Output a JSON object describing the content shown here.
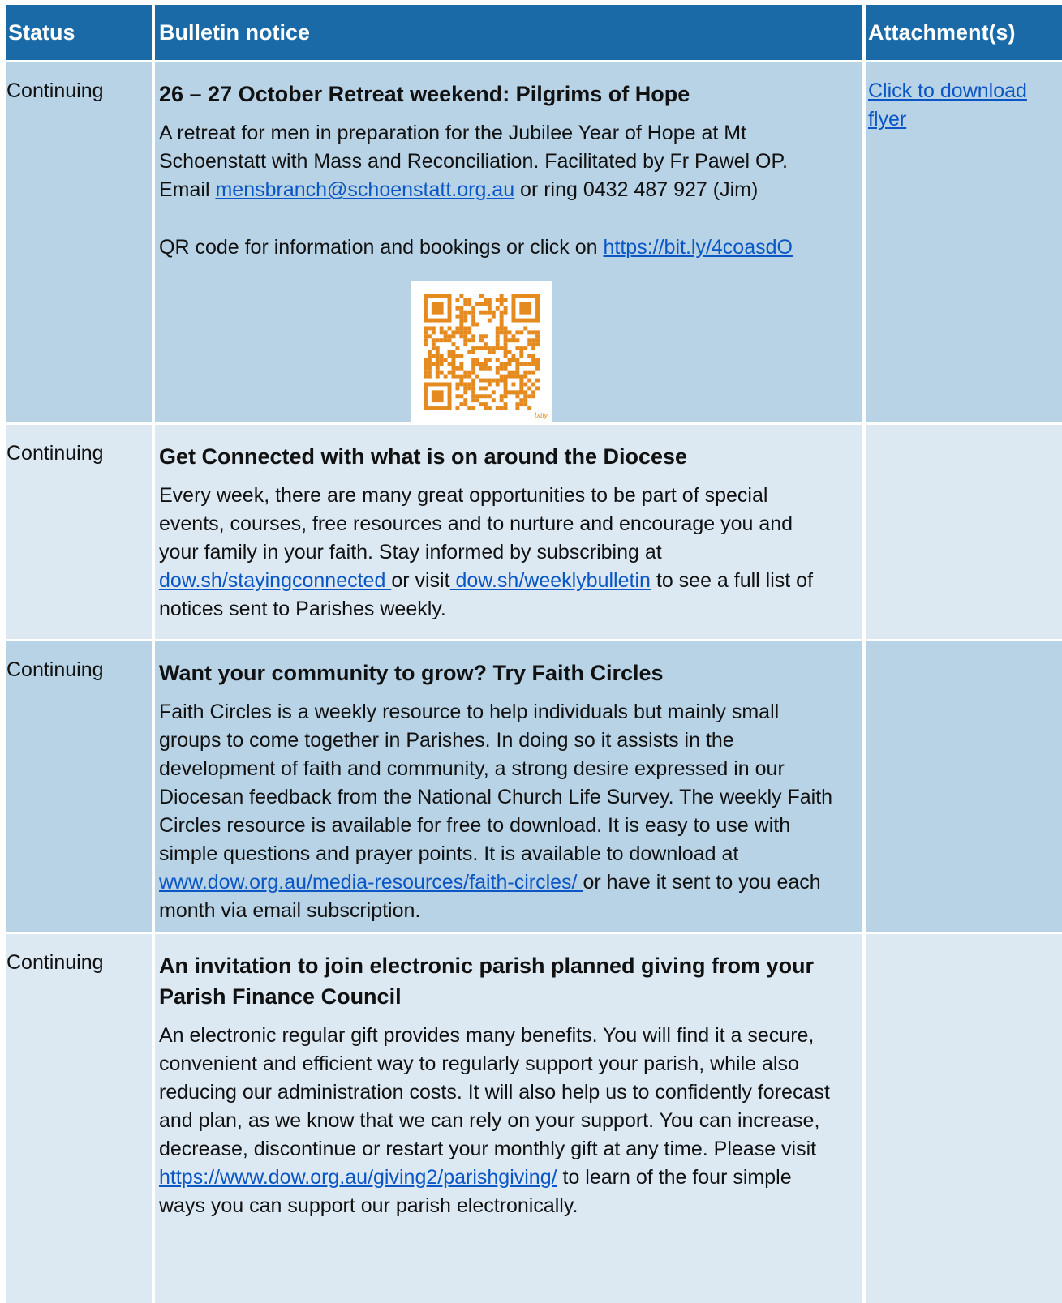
{
  "header": {
    "status": "Status",
    "notice": "Bulletin notice",
    "attachment": "Attachment(s)"
  },
  "rows": [
    {
      "status": "Continuing",
      "title": "26 – 27 October Retreat weekend: Pilgrims of Hope",
      "p1_text": "A retreat for men in preparation for the Jubilee Year of Hope at Mt Schoenstatt with Mass and Reconciliation. Facilitated by Fr Pawel OP. Email ",
      "p1_link": "mensbranch@schoenstatt.org.au",
      "p1_after": " or ring 0432 487 927 (Jim)",
      "p2_text": "QR code for information and bookings or click on ",
      "p2_link": "https://bit.ly/4coasdO",
      "qr_caption": "bitly",
      "attachment_link": "Click to download flyer"
    },
    {
      "status": "Continuing",
      "title": "Get Connected with what is on around the Diocese",
      "p1_text": "Every week, there are many great opportunities to be part of special events, courses, free resources and to nurture and encourage you and your family in your faith. Stay informed by subscribing at ",
      "p1_link": "dow.sh/stayingconnected ",
      "p1_mid": "or visit",
      "p1_link2": " dow.sh/weeklybulletin",
      "p1_after": " to see a full list of notices sent to Parishes weekly."
    },
    {
      "status": "Continuing",
      "title": "Want your community to grow? Try Faith Circles",
      "p1_text": "Faith Circles is a weekly resource to help individuals but mainly small groups to come together in Parishes. In doing so it assists in the development of faith and community, a strong desire expressed in our Diocesan feedback from the National Church Life Survey.  The weekly Faith Circles resource is available for free to download. It is easy to use with simple questions and prayer points. It is available to download at ",
      "p1_link": "www.dow.org.au/media-resources/faith-circles/ ",
      "p1_after": "or have it sent to you each month via email subscription."
    },
    {
      "status": "Continuing",
      "title": "An invitation to join electronic parish planned giving from your Parish Finance Council",
      "p1_text": "An electronic regular gift provides many benefits. You will find it a secure, convenient and efficient way to regularly support your parish, while also reducing our administration costs. It will also help us to confidently forecast and plan, as we know that we can rely on your support. You can increase, decrease, discontinue or restart your monthly gift at any time. Please visit ",
      "p1_link": "https://www.dow.org.au/giving2/parishgiving/",
      "p1_after": " to learn of the four simple ways you can support our parish electronically."
    }
  ],
  "colors": {
    "header_bg": "#1a6aa8",
    "row_dark": "#b8d3e6",
    "row_light": "#dce9f3",
    "link": "#0a56c4",
    "qr": "#e58a1f"
  }
}
